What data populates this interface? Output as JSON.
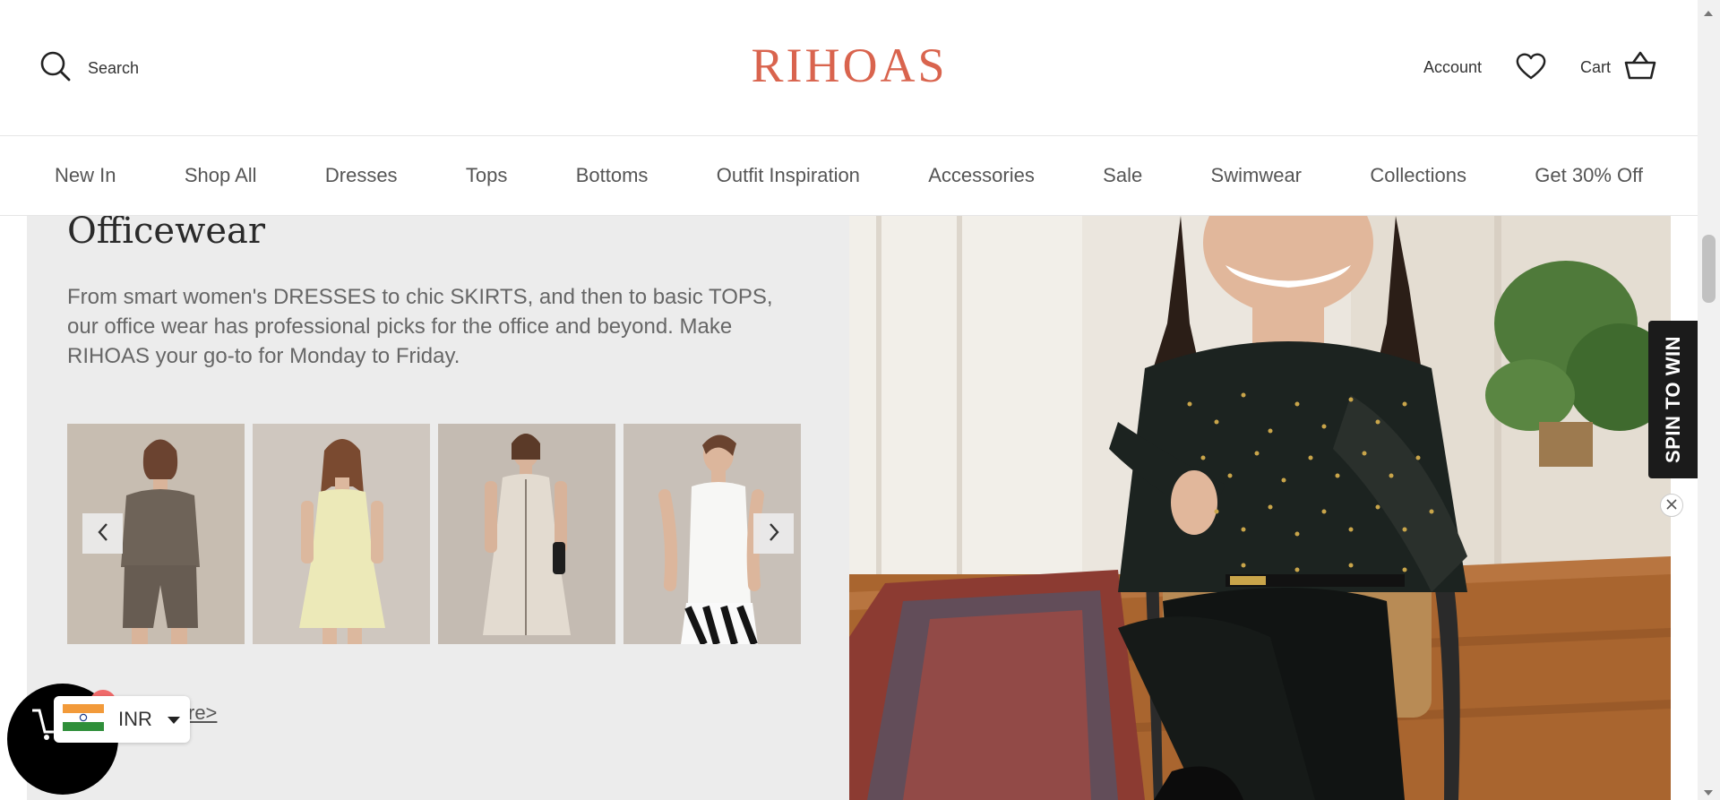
{
  "header": {
    "search_label": "Search",
    "logo": "RIHOAS",
    "account_label": "Account",
    "cart_label": "Cart"
  },
  "nav": {
    "items": [
      "New In",
      "Shop All",
      "Dresses",
      "Tops",
      "Bottoms",
      "Outfit Inspiration",
      "Accessories",
      "Sale",
      "Swimwear",
      "Collections",
      "Get 30% Off"
    ]
  },
  "section": {
    "heading": "Officewear",
    "description": "From smart women's DRESSES to chic SKIRTS, and then to basic TOPS, our office wear has professional picks for the office and beyond. Make RIHOAS your go-to for Monday to Friday.",
    "explore_label": "re>"
  },
  "promo": {
    "spin_label": "SPIN TO WIN"
  },
  "currency": {
    "code": "INR"
  },
  "colors": {
    "brand": "#d9644e",
    "section_bg": "#ececec",
    "spin_bg": "#1b1b1b"
  },
  "icons": [
    "search-icon",
    "heart-icon",
    "cart-icon",
    "chevron-left-icon",
    "chevron-right-icon",
    "close-icon",
    "india-flag-icon",
    "caret-down-icon",
    "shopping-cart-icon"
  ]
}
